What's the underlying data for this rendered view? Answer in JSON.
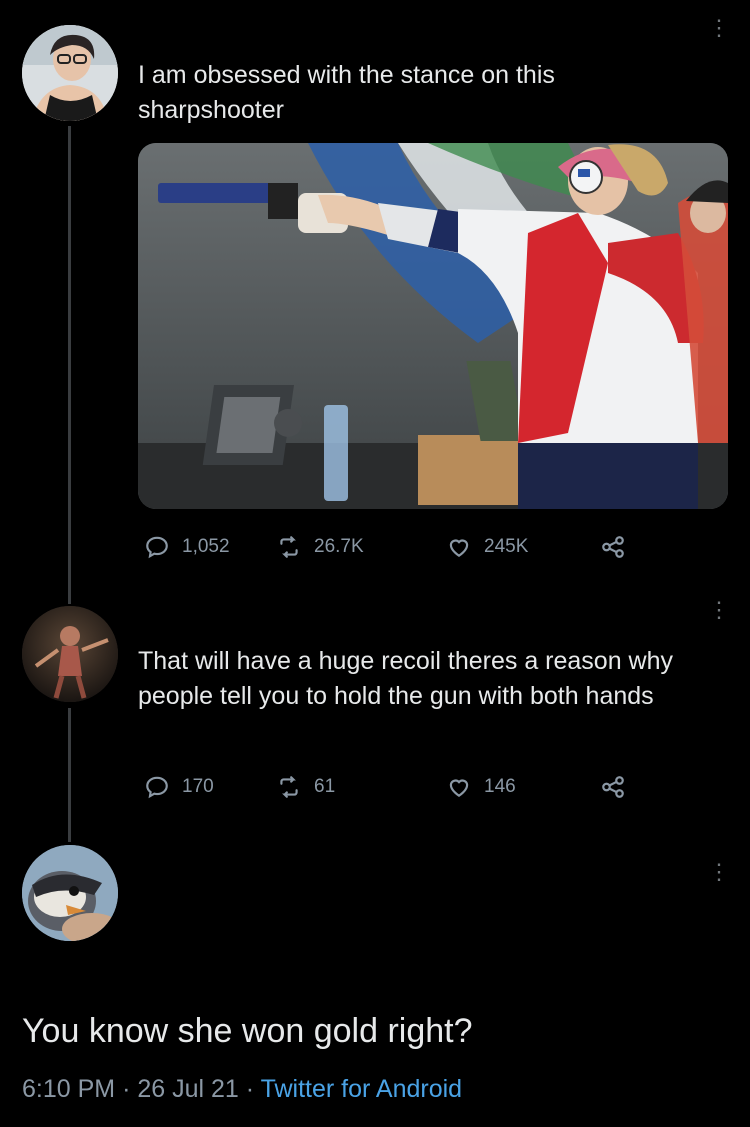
{
  "tweet1": {
    "text": "I am obsessed with the stance on this sharpshooter",
    "image_alt": "sharpshooter",
    "stats": {
      "replies": "1,052",
      "retweets": "26.7K",
      "likes": "245K"
    }
  },
  "tweet2": {
    "text": "That will have a huge recoil theres a reason why people tell you to hold the gun with both hands",
    "stats": {
      "replies": "170",
      "retweets": "61",
      "likes": "146"
    }
  },
  "tweet3": {
    "text": "You know she won gold right?",
    "time": "6:10 PM",
    "date": "26 Jul 21",
    "source": "Twitter for Android",
    "sep": "·"
  },
  "icons": [
    "reply-icon",
    "retweet-icon",
    "like-icon",
    "share-icon",
    "more-icon"
  ],
  "colors": {
    "background": "#000000",
    "text": "#e7e9ea",
    "muted": "#8b98a5",
    "link": "#4aa3e6",
    "thread_line": "#3a3d40"
  }
}
